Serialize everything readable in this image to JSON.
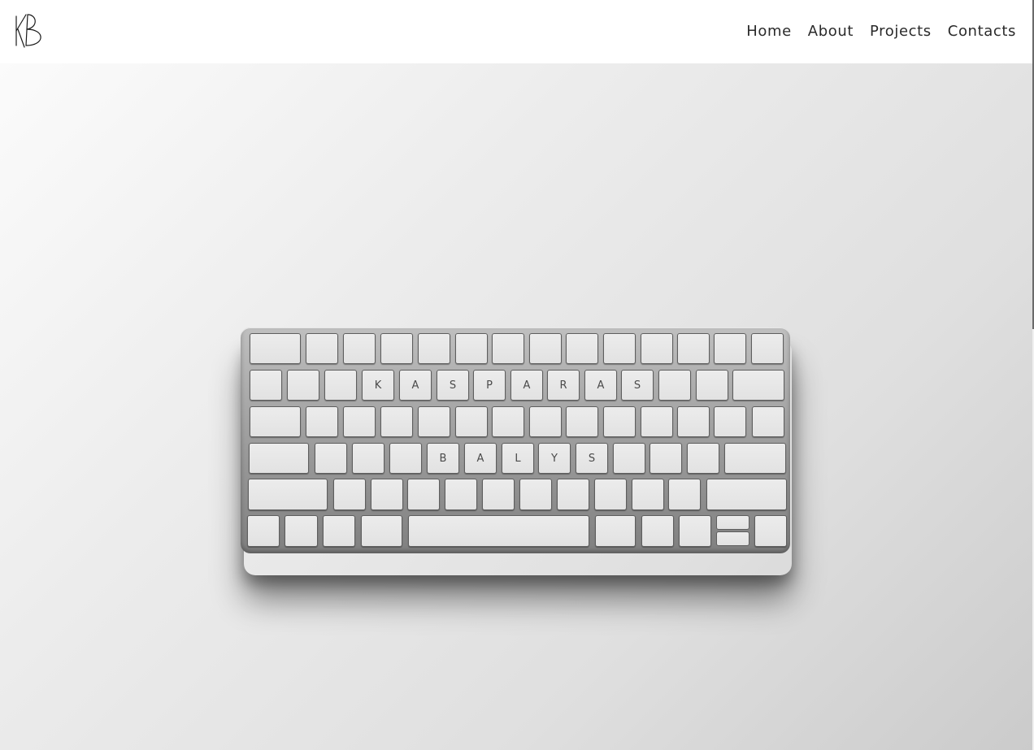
{
  "header": {
    "logo_alt": "KB",
    "nav": [
      {
        "label": "Home"
      },
      {
        "label": "About"
      },
      {
        "label": "Projects"
      },
      {
        "label": "Contacts"
      }
    ]
  },
  "hero": {
    "keyboard": {
      "row2_letters": [
        "K",
        "A",
        "S",
        "P",
        "A",
        "R",
        "A",
        "S"
      ],
      "row4_letters": [
        "B",
        "A",
        "L",
        "Y",
        "S"
      ]
    }
  },
  "colors": {
    "nav_text": "#2a2a2a",
    "background_light": "#fbfbfb",
    "background_dark": "#cbcbcb"
  }
}
